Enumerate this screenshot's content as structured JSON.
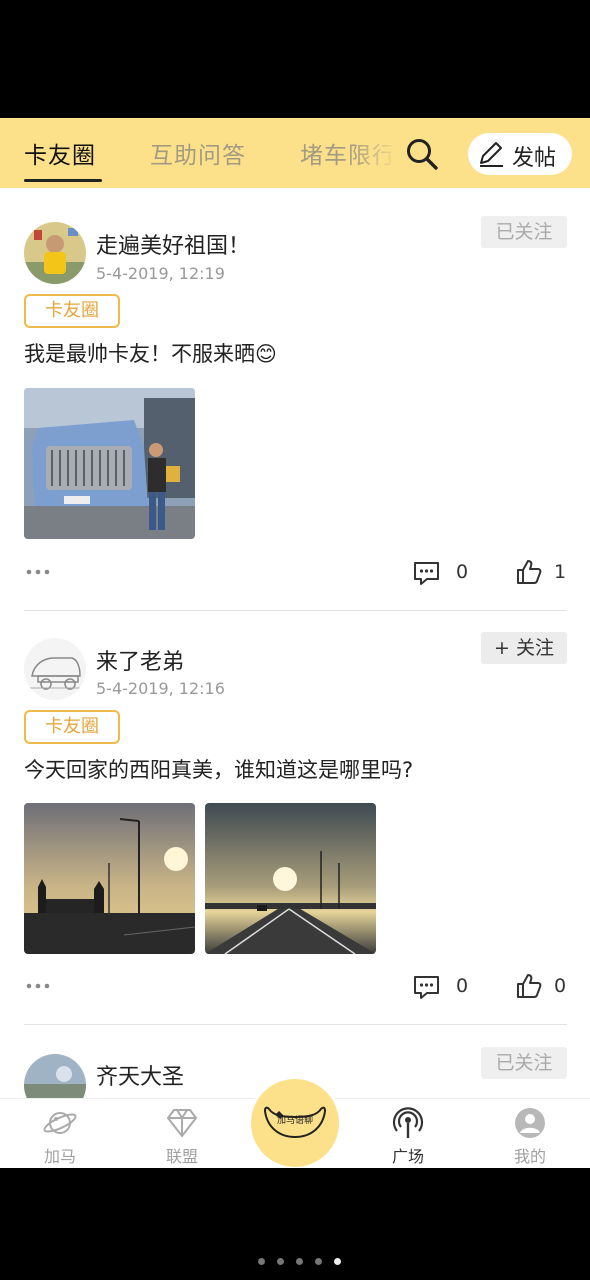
{
  "tabs": [
    {
      "label": "卡友圈",
      "active": true
    },
    {
      "label": "互助问答",
      "active": false
    },
    {
      "label": "堵车限行",
      "active": false
    }
  ],
  "post_button": {
    "label": "发帖"
  },
  "posts": [
    {
      "user": "走遍美好祖国！",
      "time": "5-4-2019, 12:19",
      "follow": "已关注",
      "tag": "卡友圈",
      "text": "我是最帅卡友！不服来晒😊",
      "comments": "0",
      "likes": "1"
    },
    {
      "user": "来了老弟",
      "time": "5-4-2019, 12:16",
      "follow": "+ 关注",
      "tag": "卡友圈",
      "text": "今天回家的西阳真美，谁知道这是哪里吗?",
      "comments": "0",
      "likes": "0"
    },
    {
      "user": "齐天大圣",
      "follow": "已关注"
    }
  ],
  "bottom_nav": [
    {
      "label": "加马",
      "icon": "planet-icon"
    },
    {
      "label": "联盟",
      "icon": "diamond-icon"
    },
    {
      "label": "加马语聊",
      "icon": "horse-logo"
    },
    {
      "label": "广场",
      "icon": "broadcast-icon",
      "active": true
    },
    {
      "label": "我的",
      "icon": "profile-icon"
    }
  ],
  "colors": {
    "accent": "#fde18a",
    "tag": "#f0b94b",
    "page_bg": "#ffffff"
  },
  "page_dots": {
    "count": 5,
    "active_index": 4
  }
}
